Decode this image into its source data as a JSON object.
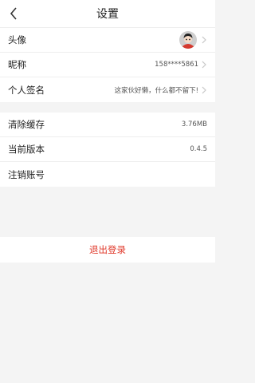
{
  "header": {
    "title": "设置"
  },
  "profile": {
    "avatar_label": "头像",
    "nickname_label": "昵称",
    "nickname_value": "158****5861",
    "signature_label": "个人签名",
    "signature_value": "这家伙好懒，什么都不留下!"
  },
  "system": {
    "cache_label": "清除缓存",
    "cache_value": "3.76MB",
    "version_label": "当前版本",
    "version_value": "0.4.5",
    "deregister_label": "注销账号"
  },
  "logout": {
    "label": "退出登录"
  },
  "colors": {
    "accent": "#e0392b",
    "background": "#f4f4f4"
  }
}
